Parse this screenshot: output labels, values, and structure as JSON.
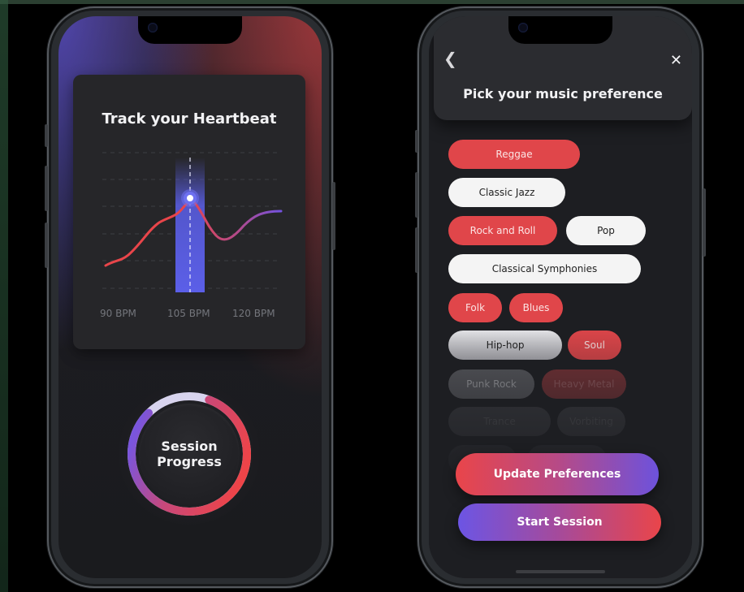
{
  "left_screen": {
    "heartbeat_card": {
      "title": "Track your Heartbeat",
      "bpm_labels": [
        "90 BPM",
        "105 BPM",
        "120 BPM"
      ],
      "highlighted_bpm": "105 BPM"
    },
    "session_progress": {
      "label_line1": "Session",
      "label_line2": "Progress",
      "progress_fraction": 0.82
    }
  },
  "right_screen": {
    "header": {
      "back_icon": "chevron-left-icon",
      "close_icon": "close-icon",
      "title": "Pick your music preference"
    },
    "genres": [
      {
        "label": "Reggae",
        "state": "selected"
      },
      {
        "label": "Classic Jazz",
        "state": "unselected"
      },
      {
        "label": "Rock and Roll",
        "state": "selected"
      },
      {
        "label": "Pop",
        "state": "unselected"
      },
      {
        "label": "Classical Symphonies",
        "state": "unselected"
      },
      {
        "label": "Folk",
        "state": "selected"
      },
      {
        "label": "Blues",
        "state": "selected"
      },
      {
        "label": "Hip-hop",
        "state": "unselected"
      },
      {
        "label": "Soul",
        "state": "selected"
      },
      {
        "label": "Punk Rock",
        "state": "unselected"
      },
      {
        "label": "Heavy Metal",
        "state": "selected"
      },
      {
        "label": "Trance",
        "state": "unselected"
      },
      {
        "label": "Vorbiting",
        "state": "unselected"
      },
      {
        "label": "",
        "state": "unselected"
      },
      {
        "label": "",
        "state": "unselected"
      }
    ],
    "update_button": "Update Preferences",
    "start_button": "Start Session"
  },
  "colors": {
    "accent_red": "#e0464a",
    "accent_purple": "#6d52dc",
    "background": "#000000"
  }
}
